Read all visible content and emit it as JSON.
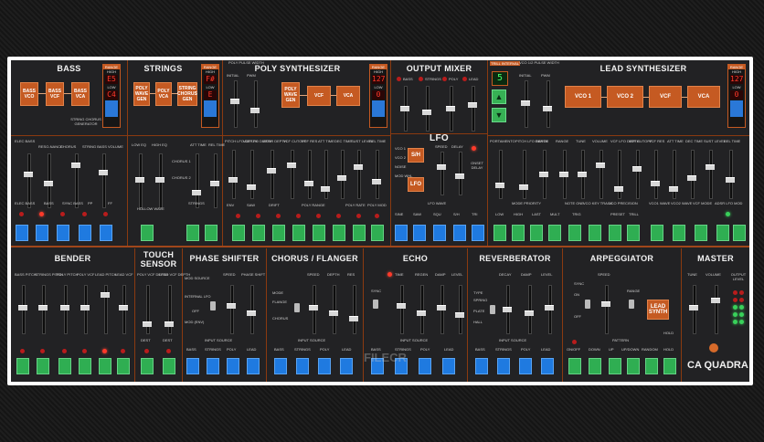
{
  "row1": {
    "bass": {
      "title": "BASS",
      "boxes": [
        "BASS VCO",
        "BASS VCF",
        "BASS VCA"
      ],
      "generator": "STRING CHORUS GENERATOR",
      "range": {
        "label": "RANGE",
        "high_label": "HIGH",
        "high": "E5",
        "low_label": "LOW",
        "low": "C4",
        "learn": "LEARN"
      },
      "labels": [
        "ELEC BASS",
        "RESO-NANCE",
        "CHORUS",
        "STRING BASS VOLUME",
        "SINE",
        "SAW",
        "LP ELECTRIC",
        "SUPER EFFECT",
        "BRIGHT",
        "AMBIENT",
        "ELEC BASS",
        "ACOU BASS",
        "SYNC",
        "HAMMER",
        "VOLUME"
      ],
      "buttons": [
        "ELEC BASS",
        "BASS",
        "SYNC BASS",
        "PP",
        "FF"
      ]
    },
    "strings": {
      "title": "STRINGS",
      "boxes": [
        "POLY WAVE GEN",
        "POLY VCA",
        "STRING CHORUS GEN"
      ],
      "range": {
        "label": "RANGE",
        "high_label": "HIGH",
        "high": "F#",
        "low_label": "LOW",
        "low": "E",
        "learn": "LEARN"
      },
      "labels": [
        "LOW EQ",
        "HIGH EQ",
        "ATT TIME",
        "REL TIME",
        "WAVE",
        "STRINGS",
        "HARD",
        "CHORUS 1",
        "CHORUS 2"
      ],
      "buttons": [
        "HOLLOW WAVE",
        "STRINGS"
      ]
    },
    "poly": {
      "title": "POLY SYNTHESIZER",
      "pulse": "POLY PULSE WIDTH",
      "boxes": [
        "POLY WAVE GEN",
        "VCF",
        "VCA"
      ],
      "range": {
        "label": "RANGE",
        "high_label": "HIGH",
        "high": "127",
        "low_label": "LOW",
        "low": "0",
        "learn": "LEARN"
      },
      "labels": [
        "INITIAL",
        "PWM",
        "PITCH LFO DEPTH",
        "VCF LFO DEPTH",
        "ADSR DEPTH",
        "VCF CUTOFF",
        "VCF RES",
        "ATT TIME",
        "DEC TIME",
        "SUST LEVEL",
        "REL TIME",
        "POLY PORTA",
        "NOISE FREQ",
        "CHORD PLAY",
        "POLY RANGE"
      ],
      "buttons": [
        "ENV",
        "SAW",
        "DRIFT",
        "POLY RANGE",
        "POLY RATE",
        "POLY MOD"
      ]
    },
    "mixer": {
      "title": "OUTPUT MIXER",
      "channels": [
        "BASS",
        "STRINGS",
        "POLY",
        "LEAD"
      ]
    },
    "lfo": {
      "title": "LFO",
      "labels": [
        "VCO 1",
        "VCO 2",
        "NOISE",
        "MOD WHL",
        "S/H",
        "LFO",
        "SPEED",
        "DELAY",
        "SINE",
        "SAW",
        "SQU",
        "S/H",
        "TRI",
        "SLOW",
        "ONSET DELAY",
        "LFO WAVE"
      ]
    },
    "lead": {
      "title": "LEAD SYNTHESIZER",
      "tape_label": "TRILL INTERVAL",
      "tape_value": "5",
      "pulse": "VCO 1/2 PULSE WIDTH",
      "boxes": [
        "VCO 1",
        "VCO 2",
        "VCF",
        "VCA"
      ],
      "range": {
        "label": "RANGE",
        "high_label": "HIGH",
        "high": "127",
        "low_label": "LOW",
        "low": "0",
        "learn": "LEARN"
      },
      "labels": [
        "VCO 1",
        "VCO 2",
        "INITIAL",
        "PWM",
        "PORTAMENTO",
        "PITCH LFO DEPTH",
        "RANGE",
        "RANGE",
        "TUNE",
        "VOLUME",
        "VCF LFO DEPTH",
        "VCF CUTOFF",
        "VCF RES",
        "ATT TIME",
        "DEC TIME",
        "SUST LEVEL",
        "REL TIME",
        "MODE PRIORITY",
        "NOTE ONE",
        "VCO KEY TRACK",
        "VCO PRECISION",
        "VCO1 WAVE",
        "VCO2 WAVE",
        "VCF MODE",
        "ADSR LFO MOD"
      ],
      "buttons": [
        "LOW",
        "HIGH",
        "LAST",
        "MULT",
        "TRIG",
        "PRESET",
        "TRILL"
      ]
    }
  },
  "row2": {
    "bender": {
      "title": "BENDER",
      "labels": [
        "BASS PITCH",
        "STRINGS PITCH",
        "POLY PITCH",
        "POLY VCF",
        "LEAD PITCH",
        "LEAD VCF"
      ]
    },
    "touch": {
      "title": "TOUCH SENSOR",
      "labels": [
        "POLY VCF DEPTH",
        "LEAD VCF DEPTH",
        "DEST",
        "DEST"
      ]
    },
    "phaser": {
      "title": "PHASE SHIFTER",
      "labels": [
        "MOD SOURCE",
        "SPEED",
        "PHASE SHIFT",
        "INTERNAL LFO",
        "LFO",
        "OFF",
        "MOD (ENV)",
        "INPUT SOURCE"
      ],
      "inputs": [
        "BASS",
        "STRINGS",
        "POLY",
        "LEAD"
      ]
    },
    "chorus": {
      "title": "CHORUS / FLANGER",
      "labels": [
        "SPEED",
        "DEPTH",
        "RES",
        "MODE",
        "FLANGE",
        "CHORUS",
        "INPUT SOURCE"
      ],
      "inputs": [
        "BASS",
        "STRINGS",
        "POLY",
        "LEAD"
      ]
    },
    "echo": {
      "title": "ECHO",
      "labels": [
        "TIME",
        "REGEN",
        "DAMP",
        "LEVEL",
        "SYNC",
        "INPUT SOURCE"
      ],
      "inputs": [
        "BASS",
        "STRINGS",
        "POLY",
        "LEAD"
      ]
    },
    "reverb": {
      "title": "REVERBERATOR",
      "labels": [
        "DECAY",
        "DAMP",
        "LEVEL",
        "TYPE",
        "SPRING",
        "PLATE",
        "HALL",
        "INPUT SOURCE"
      ],
      "inputs": [
        "BASS",
        "STRINGS",
        "POLY",
        "LEAD"
      ]
    },
    "arp": {
      "title": "ARPEGGIATOR",
      "labels": [
        "SPEED",
        "SYNC",
        "ON",
        "OFF",
        "RANGE",
        "LEAD SYNTH",
        "HOLD",
        "PATTERN"
      ],
      "modes": [
        "ON/OFF",
        "DOWN",
        "UP",
        "UP/DOWN",
        "RANDOM",
        "HOLD"
      ]
    },
    "master": {
      "title": "MASTER",
      "labels": [
        "TUNE",
        "VOLUME",
        "OUTPUT LEVEL"
      ],
      "brand": "CA QUADRA"
    }
  },
  "watermark": "FILECR"
}
